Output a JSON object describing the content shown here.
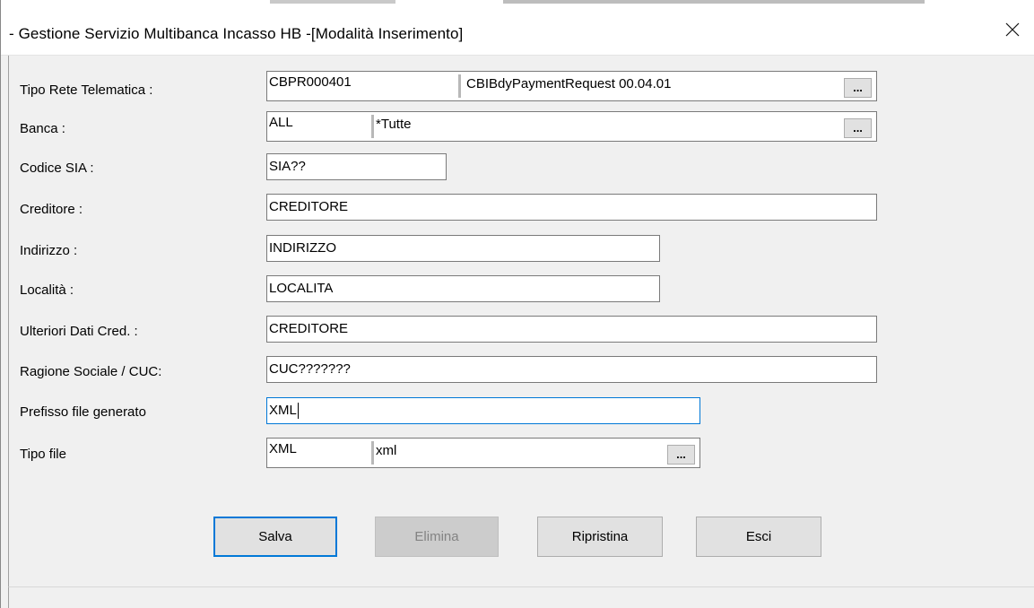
{
  "window": {
    "title": "- Gestione Servizio Multibanca Incasso HB -[Modalità Inserimento]",
    "close_glyph": "✕"
  },
  "form": {
    "tipo_rete": {
      "label": "Tipo Rete Telematica :",
      "code": "CBPR000401",
      "description": "CBIBdyPaymentRequest 00.04.01",
      "lookup": "..."
    },
    "banca": {
      "label": "Banca :",
      "code": "ALL",
      "description": "*Tutte",
      "lookup": "..."
    },
    "codice_sia": {
      "label": "Codice SIA :",
      "value": "SIA??"
    },
    "creditore": {
      "label": "Creditore :",
      "value": "CREDITORE"
    },
    "indirizzo": {
      "label": "Indirizzo :",
      "value": "INDIRIZZO"
    },
    "localita": {
      "label": "Località :",
      "value": "LOCALITA"
    },
    "ulteriori_dati": {
      "label": "Ulteriori Dati Cred. :",
      "value": "CREDITORE"
    },
    "ragione_sociale": {
      "label": "Ragione Sociale / CUC:",
      "value": "CUC???????"
    },
    "prefisso_file": {
      "label": "Prefisso file generato",
      "value": "XML"
    },
    "tipo_file": {
      "label": "Tipo file",
      "code": "XML",
      "description": "xml",
      "lookup": "..."
    }
  },
  "buttons": {
    "salva": "Salva",
    "elimina": "Elimina",
    "ripristina": "Ripristina",
    "esci": "Esci"
  },
  "colors": {
    "focus_border": "#0078d7",
    "window_bg": "#f0f0f0",
    "button_bg": "#e1e1e1"
  }
}
